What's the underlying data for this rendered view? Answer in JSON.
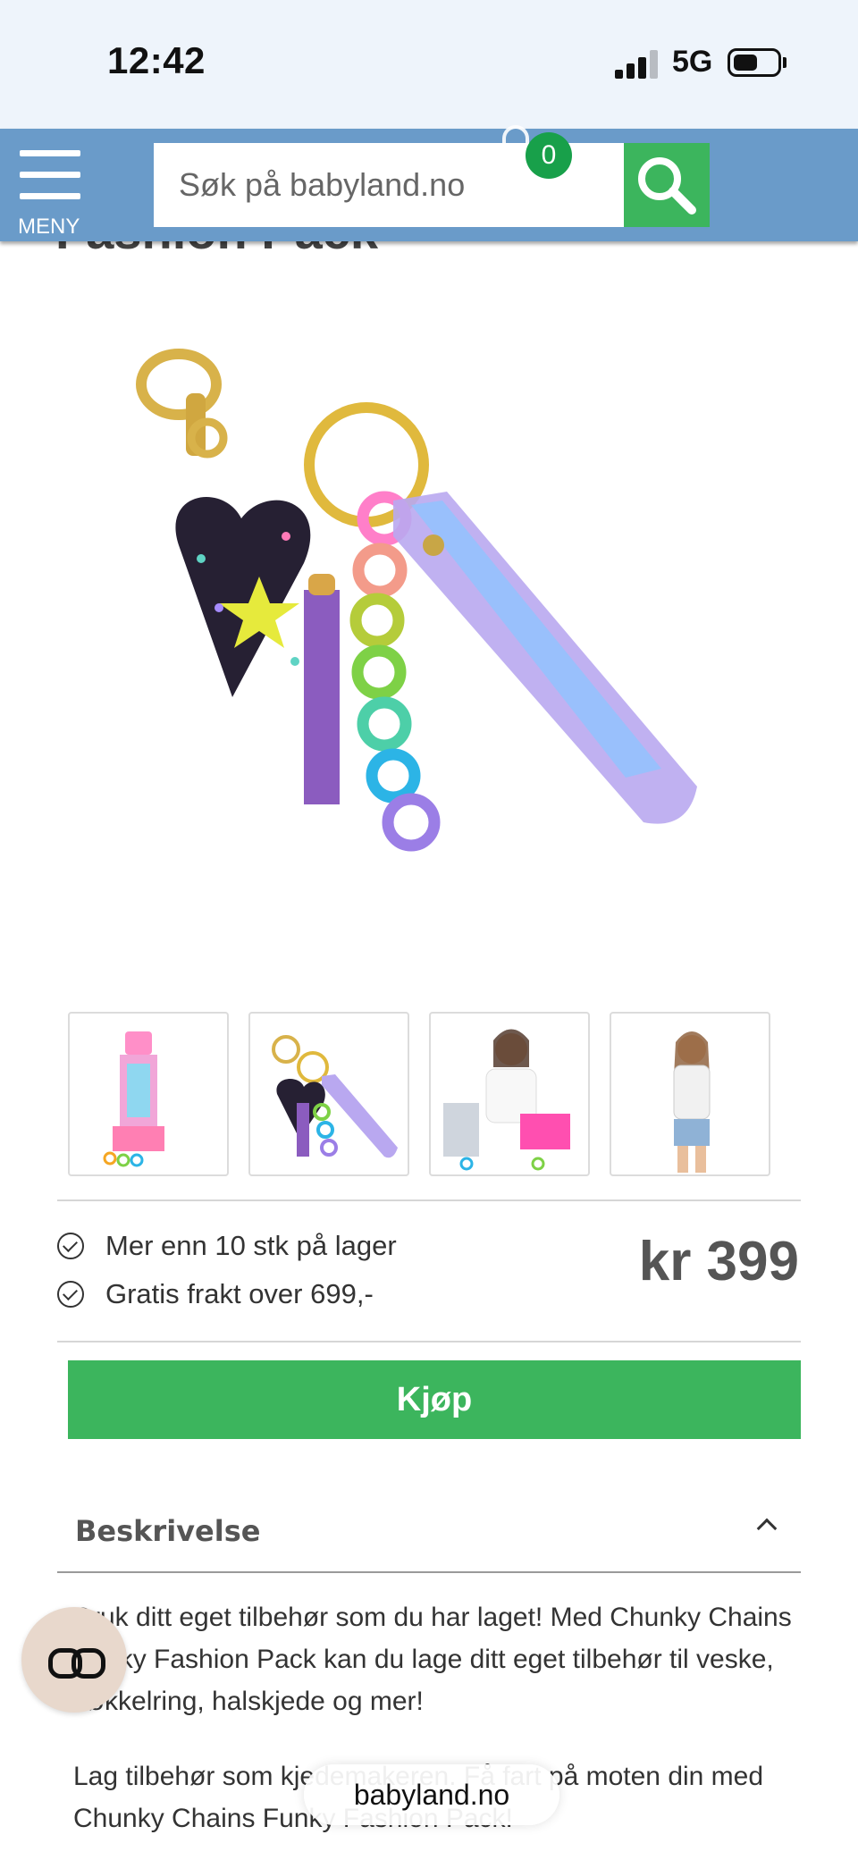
{
  "status_bar": {
    "time": "12:42",
    "network": "5G"
  },
  "header": {
    "menu_label": "MENY",
    "search_placeholder": "Søk på babyland.no",
    "cart_count": "0"
  },
  "product": {
    "title": "Fashion Pack",
    "thumbnails": [
      "tower-kit",
      "keychain",
      "girl-with-kit",
      "girl-posing"
    ],
    "stock": "Mer enn 10 stk på lager",
    "shipping": "Gratis frakt over 699,-",
    "price": "kr 399",
    "buy_label": "Kjøp"
  },
  "description": {
    "heading": "Beskrivelse",
    "paragraph1": "Bruk ditt eget tilbehør som du har laget! Med Chunky Chains Funky Fashion Pack kan du lage ditt eget tilbehør til veske, nøkkelring, halskjede og mer!",
    "paragraph2": "Lag tilbehør som kjedemakeren. Få fart på moten din med Chunky Chains Funky Fashion Pack!"
  },
  "browser": {
    "url": "babyland.no"
  },
  "colors": {
    "header_bg": "#6a9bc9",
    "accent_green": "#3cb55d",
    "badge_green": "#18a04a"
  }
}
